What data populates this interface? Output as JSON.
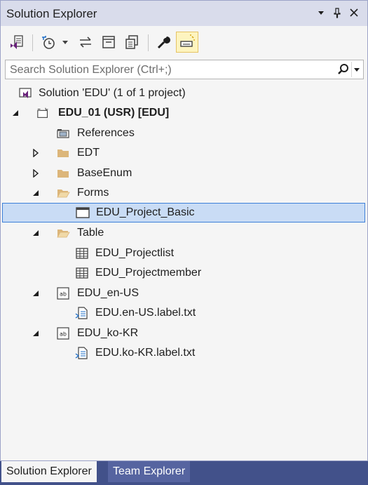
{
  "window": {
    "title": "Solution Explorer",
    "controls": [
      "▾",
      "⊥",
      "✕"
    ]
  },
  "toolbar": {
    "buttons": [
      {
        "icon": "vs-document-icon"
      },
      {
        "icon": "history-icon"
      },
      {
        "icon": "history-dropdown-icon"
      },
      {
        "icon": "sync-icon"
      },
      {
        "icon": "collapse-all-icon"
      },
      {
        "icon": "copy-view-icon"
      },
      {
        "icon": "wrench-icon"
      },
      {
        "icon": "preview-icon",
        "active": true
      }
    ]
  },
  "search": {
    "placeholder": "Search Solution Explorer (Ctrl+;)"
  },
  "tree": {
    "solution_label": "Solution 'EDU' (1 of 1 project)",
    "project_label": "EDU_01 (USR) [EDU]",
    "references_label": "References",
    "edt_label": "EDT",
    "baseenum_label": "BaseEnum",
    "forms_label": "Forms",
    "form_item_label": "EDU_Project_Basic",
    "table_label": "Table",
    "table_item1_label": "EDU_Projectlist",
    "table_item2_label": "EDU_Projectmember",
    "en_label": "EDU_en-US",
    "en_file_label": "EDU.en-US.label.txt",
    "ko_label": "EDU_ko-KR",
    "ko_file_label": "EDU.ko-KR.label.txt"
  },
  "tabs": {
    "solution_explorer": "Solution Explorer",
    "team_explorer": "Team Explorer"
  },
  "colors": {
    "accent": "#68217a",
    "selection": "#c9dcf5",
    "folder": "#dcb67a",
    "tab_bar": "#42518a"
  }
}
